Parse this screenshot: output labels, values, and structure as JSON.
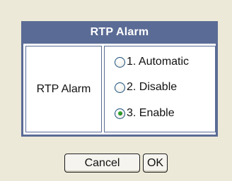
{
  "panel": {
    "title": "RTP Alarm",
    "field_label": "RTP Alarm",
    "options": [
      {
        "label": "1. Automatic",
        "checked": false
      },
      {
        "label": "2. Disable",
        "checked": false
      },
      {
        "label": "3. Enable",
        "checked": true
      }
    ]
  },
  "buttons": {
    "cancel_label": "Cancel",
    "ok_label": "OK"
  },
  "colors": {
    "header_bg": "#5a6b95",
    "page_bg": "#ece9d8",
    "radio_selected": "#2fa62f"
  }
}
